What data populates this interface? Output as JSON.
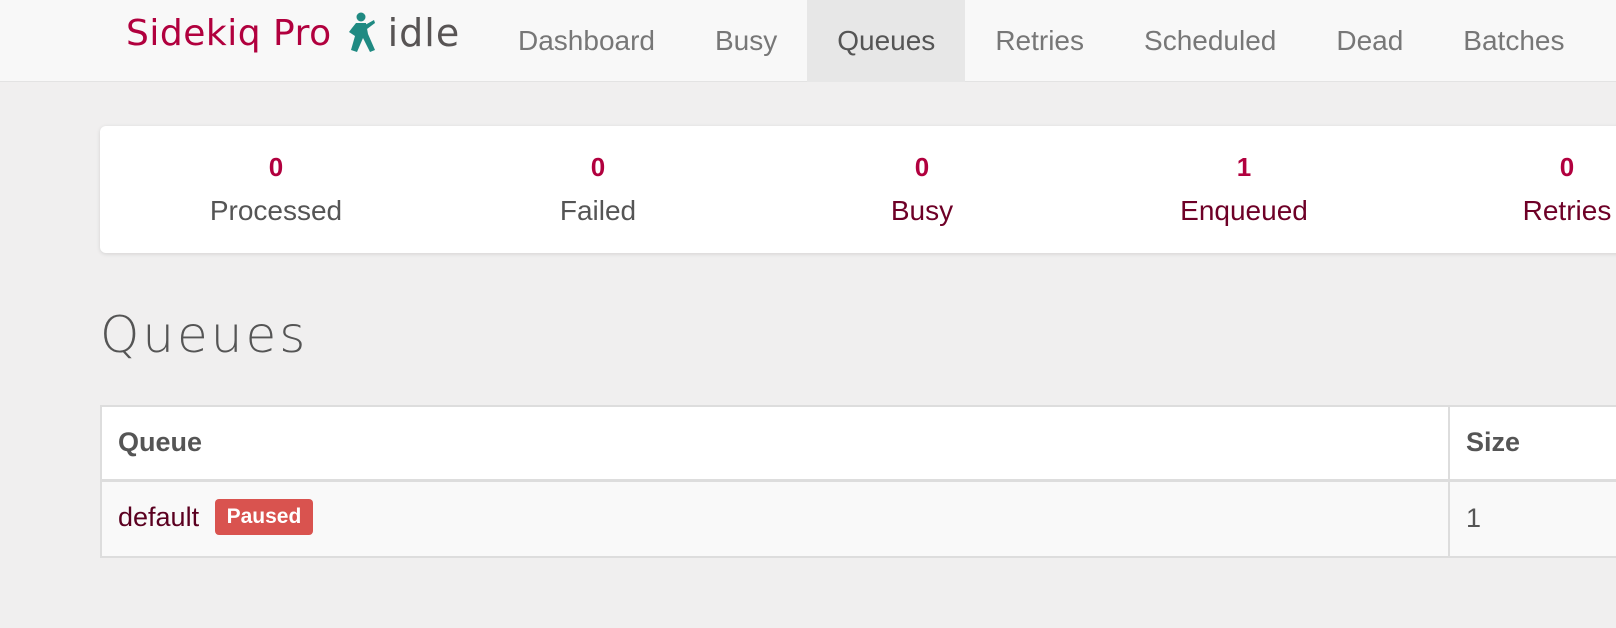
{
  "brand": {
    "name": "Sidekiq Pro",
    "icon": "sidekiq-ninja-icon",
    "status": "idle"
  },
  "nav": {
    "items": [
      {
        "label": "Dashboard",
        "active": false
      },
      {
        "label": "Busy",
        "active": false
      },
      {
        "label": "Queues",
        "active": true
      },
      {
        "label": "Retries",
        "active": false
      },
      {
        "label": "Scheduled",
        "active": false
      },
      {
        "label": "Dead",
        "active": false
      },
      {
        "label": "Batches",
        "active": false
      }
    ]
  },
  "summary": {
    "stats": [
      {
        "count": "0",
        "label": "Processed"
      },
      {
        "count": "0",
        "label": "Failed"
      },
      {
        "count": "0",
        "label": "Busy"
      },
      {
        "count": "1",
        "label": "Enqueued"
      },
      {
        "count": "0",
        "label": "Retries"
      }
    ]
  },
  "page": {
    "title": "Queues"
  },
  "table": {
    "headers": {
      "queue": "Queue",
      "size": "Size"
    },
    "rows": [
      {
        "queue": "default",
        "badge": "Paused",
        "size": "1"
      }
    ]
  },
  "colors": {
    "brand": "#b1003e",
    "icon": "#1f8a82",
    "paused_badge": "#d9534f"
  }
}
